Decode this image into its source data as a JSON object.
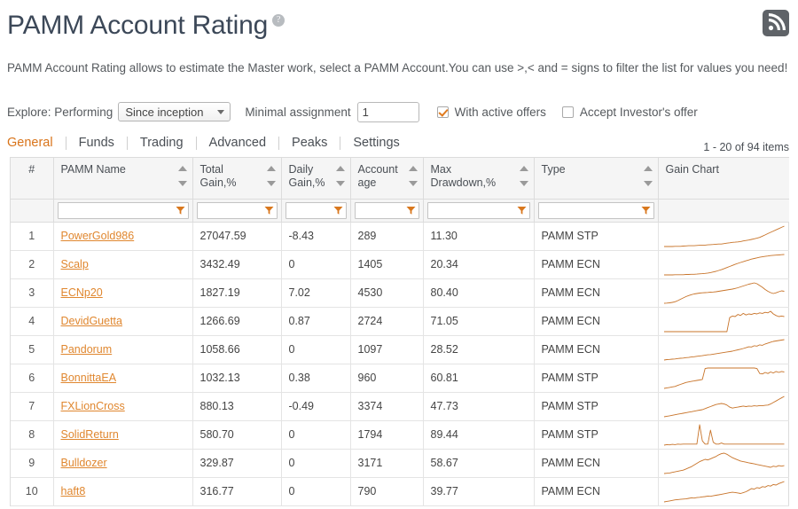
{
  "header": {
    "title": "PAMM Account Rating",
    "help_icon": "question-mark-icon",
    "rss_icon": "rss-feed-icon",
    "description": "PAMM Account Rating allows to estimate the Master work, select a PAMM Account.You can use >,< and = signs to filter the list for values you need!"
  },
  "explore": {
    "label": "Explore: Performing",
    "period_value": "Since inception",
    "period_options": [
      "Since inception"
    ],
    "minimal_assignment_label": "Minimal assignment",
    "minimal_assignment_value": "1",
    "minimal_assignment_placeholder": "",
    "checkbox_active_offers": {
      "label": "With active offers",
      "checked": true
    },
    "checkbox_investor_offer": {
      "label": "Accept Investor's offer",
      "checked": false
    }
  },
  "tabs": [
    {
      "label": "General",
      "active": true
    },
    {
      "label": "Funds",
      "active": false
    },
    {
      "label": "Trading",
      "active": false
    },
    {
      "label": "Advanced",
      "active": false
    },
    {
      "label": "Peaks",
      "active": false
    },
    {
      "label": "Settings",
      "active": false
    }
  ],
  "items_count": "1 - 20 of 94 items",
  "table": {
    "columns": [
      {
        "label": "#",
        "sortable": false,
        "filterable": false
      },
      {
        "label": "PAMM Name",
        "sortable": true,
        "filterable": true
      },
      {
        "label": "Total Gain,%",
        "sortable": true,
        "filterable": true
      },
      {
        "label": "Daily Gain,%",
        "sortable": true,
        "filterable": true
      },
      {
        "label": "Account age",
        "sortable": true,
        "filterable": true
      },
      {
        "label": "Max Drawdown,%",
        "sortable": true,
        "filterable": true
      },
      {
        "label": "Type",
        "sortable": true,
        "filterable": true
      },
      {
        "label": "Gain Chart",
        "sortable": false,
        "filterable": false
      }
    ],
    "filter_values": [
      "",
      "",
      "",
      "",
      "",
      "",
      "",
      ""
    ],
    "rows": [
      {
        "num": "1",
        "name": "PowerGold986",
        "total_gain": "27047.59",
        "daily_gain": "-8.43",
        "age": "289",
        "drawdown": "11.30",
        "type": "PAMM STP"
      },
      {
        "num": "2",
        "name": "Scalp",
        "total_gain": "3432.49",
        "daily_gain": "0",
        "age": "1405",
        "drawdown": "20.34",
        "type": "PAMM ECN"
      },
      {
        "num": "3",
        "name": "ECNp20",
        "total_gain": "1827.19",
        "daily_gain": "7.02",
        "age": "4530",
        "drawdown": "80.40",
        "type": "PAMM ECN"
      },
      {
        "num": "4",
        "name": "DevidGuetta",
        "total_gain": "1266.69",
        "daily_gain": "0.87",
        "age": "2724",
        "drawdown": "71.05",
        "type": "PAMM ECN"
      },
      {
        "num": "5",
        "name": "Pandorum",
        "total_gain": "1058.66",
        "daily_gain": "0",
        "age": "1097",
        "drawdown": "28.52",
        "type": "PAMM ECN"
      },
      {
        "num": "6",
        "name": "BonnittaEA",
        "total_gain": "1032.13",
        "daily_gain": "0.38",
        "age": "960",
        "drawdown": "60.81",
        "type": "PAMM STP"
      },
      {
        "num": "7",
        "name": "FXLionCross",
        "total_gain": "880.13",
        "daily_gain": "-0.49",
        "age": "3374",
        "drawdown": "47.73",
        "type": "PAMM STP"
      },
      {
        "num": "8",
        "name": "SolidReturn",
        "total_gain": "580.70",
        "daily_gain": "0",
        "age": "1794",
        "drawdown": "89.44",
        "type": "PAMM STP"
      },
      {
        "num": "9",
        "name": "Bulldozer",
        "total_gain": "329.87",
        "daily_gain": "0",
        "age": "3171",
        "drawdown": "58.67",
        "type": "PAMM ECN"
      },
      {
        "num": "10",
        "name": "haft8",
        "total_gain": "316.77",
        "daily_gain": "0",
        "age": "790",
        "drawdown": "39.77",
        "type": "PAMM ECN"
      }
    ]
  },
  "colors": {
    "accent": "#d9741a",
    "link": "#e0872f",
    "spark_line": "#c8742a",
    "header_bg": "#f5f5f5",
    "border": "#dcdcdc",
    "title": "#3c4858"
  },
  "chart_data": [
    {
      "type": "line",
      "title": "PowerGold986",
      "ylabel": "Gain",
      "values": [
        2,
        2,
        2,
        2,
        3,
        3,
        3,
        4,
        5,
        6,
        6,
        6,
        7,
        8,
        9,
        9,
        10,
        11,
        12,
        13,
        14,
        14,
        16,
        18,
        20,
        22,
        23,
        24,
        26,
        29,
        31,
        33,
        36,
        39,
        42,
        46,
        52,
        58,
        64,
        70,
        76,
        82,
        88,
        94,
        100
      ]
    },
    {
      "type": "line",
      "title": "Scalp",
      "ylabel": "Gain",
      "values": [
        3,
        3,
        3,
        3,
        4,
        4,
        4,
        4,
        5,
        5,
        6,
        6,
        7,
        8,
        9,
        10,
        12,
        14,
        17,
        20,
        24,
        28,
        33,
        38,
        43,
        48,
        53,
        58,
        62,
        66,
        70,
        74,
        78,
        81,
        84,
        87,
        89,
        91,
        93,
        95,
        96,
        97,
        98,
        99,
        100
      ]
    },
    {
      "type": "line",
      "title": "ECNp20",
      "ylabel": "Gain",
      "values": [
        8,
        9,
        10,
        12,
        15,
        20,
        26,
        32,
        38,
        43,
        47,
        50,
        52,
        54,
        55,
        56,
        57,
        58,
        59,
        60,
        62,
        64,
        66,
        68,
        70,
        72,
        75,
        78,
        82,
        86,
        90,
        94,
        97,
        100,
        96,
        88,
        80,
        70,
        62,
        56,
        52,
        55,
        60,
        64,
        62
      ]
    },
    {
      "type": "line",
      "title": "DevidGuetta",
      "ylabel": "Gain",
      "values": [
        5,
        5,
        5,
        5,
        5,
        5,
        5,
        5,
        5,
        5,
        5,
        5,
        5,
        5,
        5,
        5,
        5,
        5,
        5,
        5,
        5,
        5,
        5,
        5,
        58,
        64,
        62,
        70,
        66,
        74,
        68,
        72,
        70,
        74,
        72,
        76,
        74,
        78,
        76,
        82,
        72,
        66,
        62,
        64,
        62
      ]
    },
    {
      "type": "line",
      "title": "Pandorum",
      "ylabel": "Gain",
      "values": [
        6,
        8,
        9,
        10,
        11,
        13,
        14,
        15,
        17,
        18,
        20,
        21,
        23,
        25,
        26,
        28,
        30,
        31,
        33,
        35,
        37,
        39,
        41,
        43,
        45,
        47,
        50,
        53,
        56,
        59,
        63,
        67,
        66,
        72,
        70,
        76,
        74,
        80,
        84,
        88,
        92,
        94,
        96,
        98,
        100
      ]
    },
    {
      "type": "line",
      "title": "BonnittaEA",
      "ylabel": "Gain",
      "values": [
        10,
        12,
        14,
        16,
        18,
        22,
        26,
        30,
        34,
        36,
        38,
        40,
        42,
        44,
        46,
        90,
        92,
        92,
        92,
        92,
        92,
        92,
        92,
        92,
        92,
        92,
        92,
        92,
        92,
        92,
        92,
        92,
        92,
        92,
        90,
        70,
        68,
        74,
        70,
        76,
        72,
        78,
        74,
        78,
        76
      ]
    },
    {
      "type": "line",
      "title": "FXLionCross",
      "ylabel": "Gain",
      "values": [
        12,
        14,
        16,
        18,
        20,
        22,
        24,
        26,
        28,
        30,
        32,
        34,
        36,
        38,
        40,
        44,
        48,
        52,
        56,
        60,
        62,
        64,
        62,
        58,
        50,
        46,
        48,
        50,
        52,
        54,
        52,
        54,
        53,
        55,
        54,
        56,
        55,
        57,
        58,
        62,
        68,
        74,
        80,
        86,
        92
      ]
    },
    {
      "type": "line",
      "title": "SolidReturn",
      "ylabel": "Gain",
      "values": [
        14,
        16,
        15,
        17,
        16,
        18,
        17,
        18,
        18,
        18,
        18,
        18,
        18,
        90,
        30,
        18,
        18,
        70,
        25,
        18,
        18,
        22,
        18,
        18,
        18,
        18,
        18,
        18,
        18,
        18,
        18,
        18,
        18,
        18,
        18,
        18,
        18,
        18,
        18,
        18,
        18,
        18,
        18,
        18,
        18
      ]
    },
    {
      "type": "line",
      "title": "Bulldozer",
      "ylabel": "Gain",
      "values": [
        14,
        15,
        16,
        18,
        20,
        22,
        24,
        26,
        30,
        34,
        38,
        44,
        50,
        56,
        60,
        64,
        62,
        66,
        70,
        74,
        80,
        84,
        86,
        82,
        76,
        70,
        66,
        62,
        58,
        56,
        54,
        52,
        50,
        48,
        46,
        44,
        42,
        40,
        38,
        36,
        40,
        38,
        42,
        40,
        42
      ]
    },
    {
      "type": "line",
      "title": "haft8",
      "ylabel": "Gain",
      "values": [
        12,
        14,
        16,
        18,
        20,
        21,
        22,
        23,
        24,
        26,
        28,
        27,
        29,
        30,
        32,
        33,
        35,
        34,
        36,
        38,
        40,
        42,
        44,
        46,
        48,
        50,
        49,
        47,
        45,
        48,
        52,
        58,
        64,
        62,
        68,
        66,
        72,
        70,
        76,
        74,
        80,
        78,
        84,
        88,
        92
      ]
    }
  ]
}
